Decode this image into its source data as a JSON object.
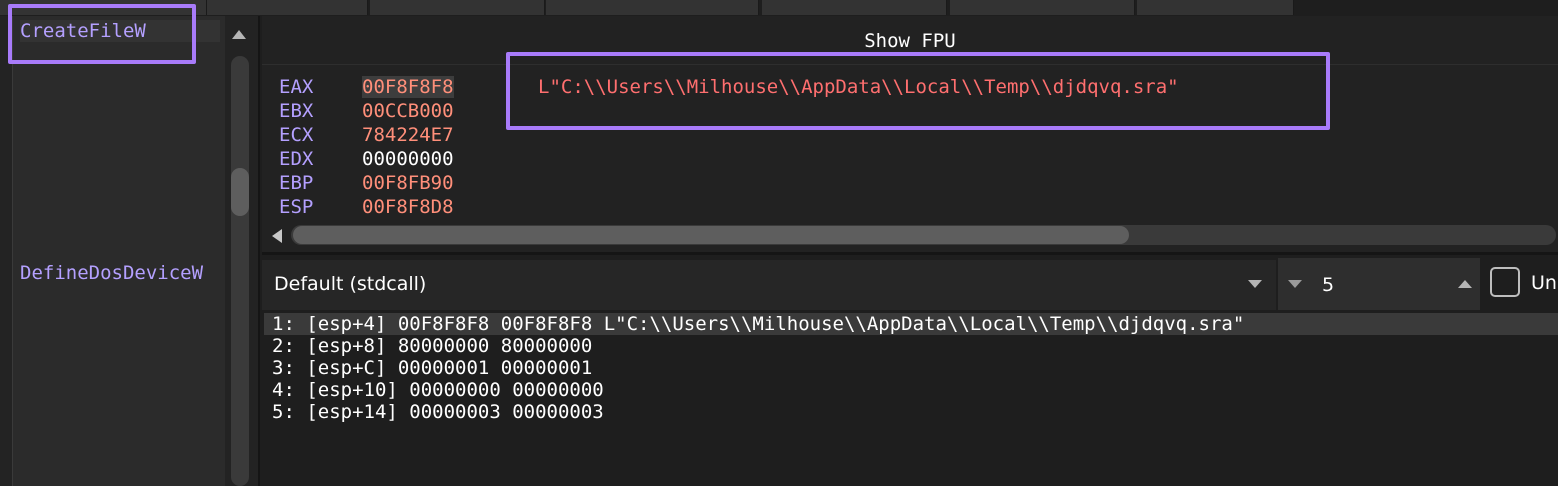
{
  "symbols": {
    "items": [
      {
        "label": "CreateFileW"
      },
      {
        "label": "DefineDosDeviceW"
      }
    ]
  },
  "registers": {
    "header": "Show FPU",
    "rows": [
      {
        "name": "EAX",
        "value": "00F8F8F8",
        "color": "#ff8f7a"
      },
      {
        "name": "EBX",
        "value": "00CCB000",
        "color": "#ff8f7a"
      },
      {
        "name": "ECX",
        "value": "784224E7",
        "color": "#ff8f7a"
      },
      {
        "name": "EDX",
        "value": "00000000",
        "color": "#ffffff"
      },
      {
        "name": "EBP",
        "value": "00F8FB90",
        "color": "#ff8f7a"
      },
      {
        "name": "ESP",
        "value": "00F8F8D8",
        "color": "#ff8f7a"
      }
    ],
    "eax_comment": "L\"C:\\\\Users\\\\Milhouse\\\\AppData\\\\Local\\\\Temp\\\\djdqvq.sra\""
  },
  "call_convention": {
    "selected": "Default (stdcall)",
    "arg_count": "5",
    "unlock_label": "Un"
  },
  "stack_args": [
    "1: [esp+4] 00F8F8F8 00F8F8F8 L\"C:\\\\Users\\\\Milhouse\\\\AppData\\\\Local\\\\Temp\\\\djdqvq.sra\"",
    "2: [esp+8] 80000000 80000000",
    "3: [esp+C] 00000001 00000001",
    "4: [esp+10] 00000000 00000000",
    "5: [esp+14] 00000003 00000003"
  ],
  "colors": {
    "register_name": "#b4a0ff",
    "register_changed": "#ff8f7a",
    "string_comment": "#ff6f6f",
    "highlight_box": "#a87bfa"
  },
  "icons": [
    "scroll-up-icon",
    "scroll-left-icon",
    "dropdown-arrow-icon",
    "spin-down-icon",
    "spin-up-icon"
  ]
}
